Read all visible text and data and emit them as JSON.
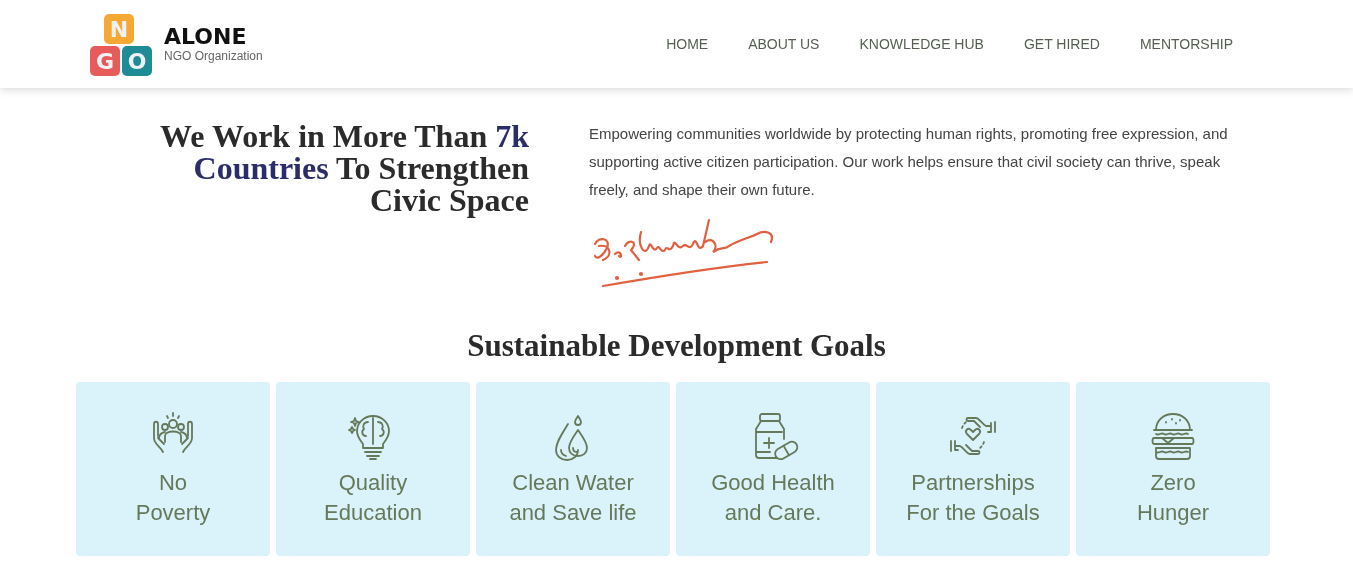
{
  "header": {
    "logo": {
      "letters": [
        "N",
        "G",
        "O"
      ],
      "name": "ALONE",
      "tagline": "NGO Organization"
    },
    "nav": [
      {
        "label": "HOME",
        "selected": false
      },
      {
        "label": "ABOUT US",
        "selected": false
      },
      {
        "label": "KNOWLEDGE HUB",
        "selected": false
      },
      {
        "label": "GET HIRED",
        "selected": false
      },
      {
        "label": "MENTORSHIP",
        "selected": false
      }
    ]
  },
  "hero": {
    "heading": [
      {
        "text": "We Work in More Than ",
        "accent": false
      },
      {
        "text": "7k Countries",
        "accent": true
      },
      {
        "text": " To Strengthen Civic Space",
        "accent": false
      }
    ],
    "text": "Empowering communities worldwide by protecting human rights, promoting free expression, and supporting active citizen participation. Our work helps ensure that civil society can thrive, speak freely, and shape their own future."
  },
  "goals": {
    "title": "Sustainable Development Goals",
    "cards": [
      {
        "kind": "people",
        "lines": [
          "No",
          "Poverty"
        ]
      },
      {
        "kind": "brain",
        "lines": [
          "Quality",
          "Education"
        ]
      },
      {
        "kind": "drops",
        "lines": [
          "Clean Water",
          "and Save life"
        ]
      },
      {
        "kind": "medicine",
        "lines": [
          "Good Health",
          "and Care."
        ]
      },
      {
        "kind": "hands",
        "lines": [
          "Partnerships",
          "For the Goals"
        ]
      },
      {
        "kind": "burger",
        "lines": [
          "Zero",
          "Hunger"
        ]
      }
    ]
  }
}
